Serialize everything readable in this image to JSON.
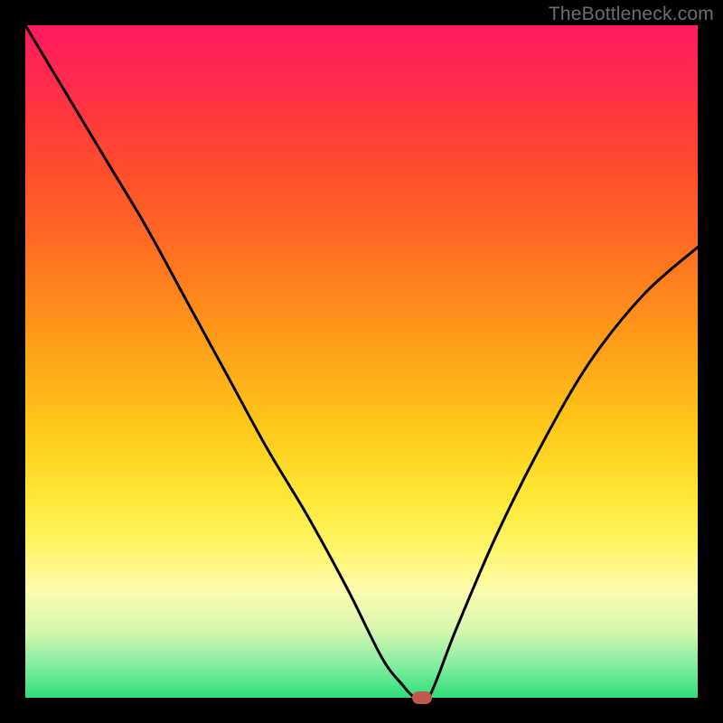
{
  "watermark": "TheBottleneck.com",
  "colors": {
    "frame": "#000000",
    "curve_stroke": "#000000",
    "marker_fill": "#c1574d",
    "gradient_stops": [
      "#ff1a60",
      "#ff2a4d",
      "#ff4433",
      "#ff6a22",
      "#ff9a1a",
      "#ffc218",
      "#ffe733",
      "#fff56b",
      "#fdfcae",
      "#d6f7b0",
      "#86eea0",
      "#2fde7a"
    ]
  },
  "chart_data": {
    "type": "line",
    "title": "",
    "xlabel": "",
    "ylabel": "",
    "xlim": [
      0,
      100
    ],
    "ylim": [
      0,
      100
    ],
    "grid": false,
    "legend": false,
    "series": [
      {
        "name": "bottleneck-curve",
        "x": [
          0,
          6,
          12,
          18,
          24,
          30,
          36,
          42,
          48,
          53,
          56,
          58,
          60,
          64,
          70,
          77,
          84,
          92,
          100
        ],
        "values": [
          100,
          90,
          80,
          70,
          59,
          48,
          37,
          27,
          16,
          6,
          2,
          0,
          0,
          10,
          24,
          38,
          50,
          60,
          67
        ]
      }
    ],
    "marker": {
      "x": 59,
      "y": 0
    },
    "notes": "Values read from gradient position; minimum plateau of ~0 at x≈57–60. Curve never reaches top-right corner; right branch tops out ≈67% at x=100."
  }
}
